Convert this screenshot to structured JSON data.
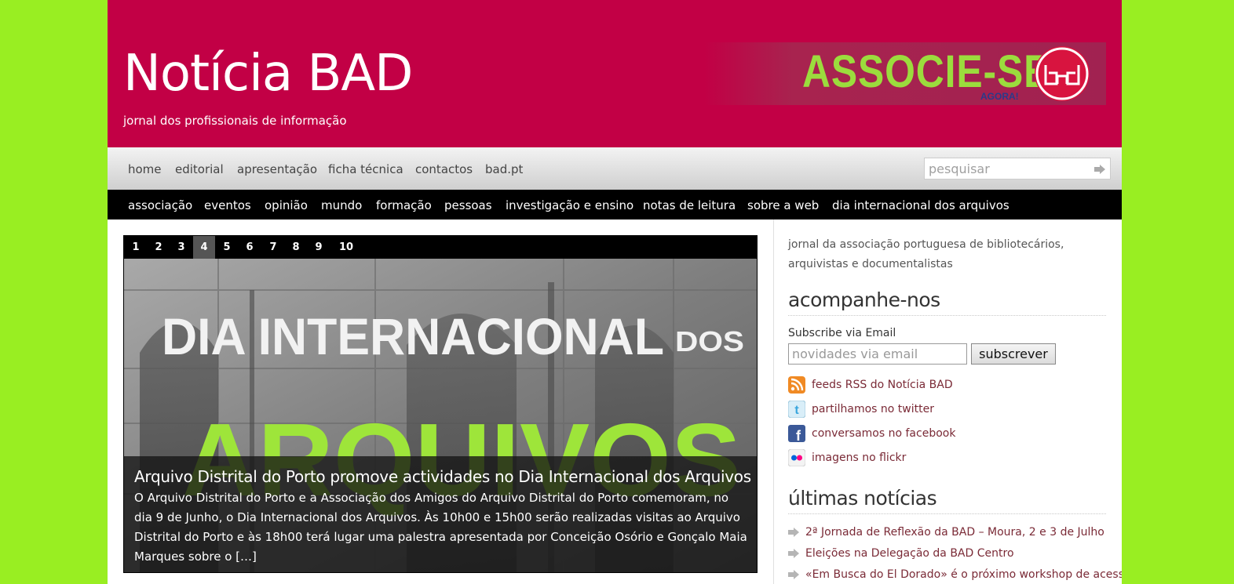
{
  "header": {
    "title": "Notícia BAD",
    "tagline": "jornal dos profissionais de informação",
    "banner": {
      "text": "ASSOCIE-SE",
      "subtext": "AGORA!"
    }
  },
  "topnav": {
    "items": [
      "home",
      "editorial",
      "apresentação",
      "ficha técnica",
      "contactos",
      "bad.pt"
    ],
    "search_placeholder": "pesquisar"
  },
  "catnav": {
    "items": [
      "associação",
      "eventos",
      "opinião",
      "mundo",
      "formação",
      "pessoas",
      "investigação e ensino",
      "notas de leitura",
      "sobre a web",
      "dia internacional dos arquivos"
    ]
  },
  "slider": {
    "pages": [
      "1",
      "2",
      "3",
      "4",
      "5",
      "6",
      "7",
      "8",
      "9",
      "10"
    ],
    "active_page": "4",
    "image_text": {
      "line1": "DIA INTERNACIONAL",
      "line1_suffix": "DOS",
      "line2": "ARQUIVOS"
    },
    "title": "Arquivo Distrital do Porto promove actividades no Dia Internacional dos Arquivos",
    "excerpt": "O Arquivo Distrital do Porto e a Associação dos Amigos do Arquivo Distrital do Porto comemoram, no dia 9 de Junho, o Dia Internacional dos Arquivos. Às 10h00 e 15h00 serão realizadas visitas ao Arquivo Distrital do Porto e às 18h00 terá lugar uma palestra apresentada por Conceição Osório e Gonçalo Maia Marques sobre o […]"
  },
  "sidebar": {
    "about": "jornal da associação portuguesa de bibliotecários, arquivistas e documentalistas",
    "follow_heading": "acompanhe-nos",
    "subscribe_label": "Subscribe via Email",
    "email_placeholder": "novidades via email",
    "subscribe_button": "subscrever",
    "social": [
      {
        "icon": "rss-icon",
        "label": "feeds RSS do Notícia BAD"
      },
      {
        "icon": "twitter-icon",
        "label": "partilhamos no twitter"
      },
      {
        "icon": "facebook-icon",
        "label": "conversamos no facebook"
      },
      {
        "icon": "flickr-icon",
        "label": "imagens no flickr"
      }
    ],
    "news_heading": "últimas notícias",
    "news": [
      "2ª Jornada de Reflexão da BAD – Moura, 2 e 3 de Julho",
      "Eleições na Delegação da BAD Centro",
      "«Em Busca do El Dorado» é o próximo workshop de acesso"
    ]
  },
  "colors": {
    "page_background": "#99ee22",
    "header_background": "#c20045",
    "link": "#7a2a36",
    "banner_text": "#9bdc3d"
  }
}
